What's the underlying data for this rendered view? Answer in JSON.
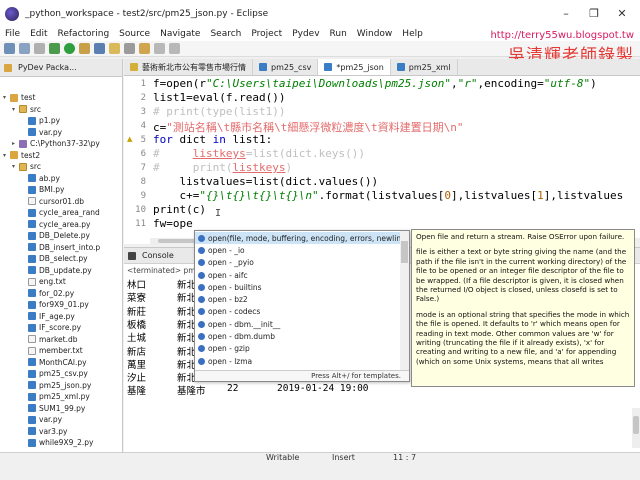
{
  "window": {
    "title": "_python_workspace - test2/src/pm25_json.py - Eclipse",
    "minimize": "–",
    "maximize": "❐",
    "close": "✕"
  },
  "watermark": {
    "url": "http://terry55wu.blogspot.tw",
    "signature": "吳清輝老師錄製"
  },
  "menu": [
    "File",
    "Edit",
    "Refactoring",
    "Source",
    "Navigate",
    "Search",
    "Project",
    "Pydev",
    "Run",
    "Window",
    "Help"
  ],
  "explorer": {
    "tab_label": "PyDev Packa...",
    "items": [
      {
        "indent": 0,
        "twisty": "▾",
        "icon": "proj",
        "label": "test"
      },
      {
        "indent": 1,
        "twisty": "▾",
        "icon": "src",
        "label": "src"
      },
      {
        "indent": 2,
        "twisty": "",
        "icon": "py",
        "label": "p1.py"
      },
      {
        "indent": 2,
        "twisty": "",
        "icon": "py",
        "label": "var.py"
      },
      {
        "indent": 1,
        "twisty": "▸",
        "icon": "lib",
        "label": "C:\\Python37-32\\py"
      },
      {
        "indent": 0,
        "twisty": "▾",
        "icon": "proj",
        "label": "test2"
      },
      {
        "indent": 1,
        "twisty": "▾",
        "icon": "src",
        "label": "src"
      },
      {
        "indent": 2,
        "twisty": "",
        "icon": "py",
        "label": "ab.py"
      },
      {
        "indent": 2,
        "twisty": "",
        "icon": "py",
        "label": "BMI.py"
      },
      {
        "indent": 2,
        "twisty": "",
        "icon": "txt",
        "label": "cursor01.db"
      },
      {
        "indent": 2,
        "twisty": "",
        "icon": "py",
        "label": "cycle_area_rand"
      },
      {
        "indent": 2,
        "twisty": "",
        "icon": "py",
        "label": "cycle_area.py"
      },
      {
        "indent": 2,
        "twisty": "",
        "icon": "py",
        "label": "DB_Delete.py"
      },
      {
        "indent": 2,
        "twisty": "",
        "icon": "py",
        "label": "DB_insert_into.p"
      },
      {
        "indent": 2,
        "twisty": "",
        "icon": "py",
        "label": "DB_select.py"
      },
      {
        "indent": 2,
        "twisty": "",
        "icon": "py",
        "label": "DB_update.py"
      },
      {
        "indent": 2,
        "twisty": "",
        "icon": "txt",
        "label": "eng.txt"
      },
      {
        "indent": 2,
        "twisty": "",
        "icon": "py",
        "label": "for_02.py"
      },
      {
        "indent": 2,
        "twisty": "",
        "icon": "py",
        "label": "for9X9_01.py"
      },
      {
        "indent": 2,
        "twisty": "",
        "icon": "py",
        "label": "IF_age.py"
      },
      {
        "indent": 2,
        "twisty": "",
        "icon": "py",
        "label": "IF_score.py"
      },
      {
        "indent": 2,
        "twisty": "",
        "icon": "txt",
        "label": "market.db"
      },
      {
        "indent": 2,
        "twisty": "",
        "icon": "txt",
        "label": "member.txt"
      },
      {
        "indent": 2,
        "twisty": "",
        "icon": "py",
        "label": "MonthCAl.py"
      },
      {
        "indent": 2,
        "twisty": "",
        "icon": "py",
        "label": "pm25_csv.py"
      },
      {
        "indent": 2,
        "twisty": "",
        "icon": "py",
        "label": "pm25_json.py"
      },
      {
        "indent": 2,
        "twisty": "",
        "icon": "py",
        "label": "pm25_xml.py"
      },
      {
        "indent": 2,
        "twisty": "",
        "icon": "py",
        "label": "SUM1_99.py"
      },
      {
        "indent": 2,
        "twisty": "",
        "icon": "py",
        "label": "var.py"
      },
      {
        "indent": 2,
        "twisty": "",
        "icon": "py",
        "label": "var3.py"
      },
      {
        "indent": 2,
        "twisty": "",
        "icon": "py",
        "label": "while9X9_2.py"
      }
    ]
  },
  "editor_tabs": [
    {
      "label": "藝術新北市公有零售市場行情",
      "active": false
    },
    {
      "label": "pm25_csv",
      "active": false
    },
    {
      "label": "*pm25_json",
      "active": true
    },
    {
      "label": "pm25_xml",
      "active": false
    }
  ],
  "editor": {
    "line_numbers": [
      "1",
      "2",
      "3",
      "4",
      "5",
      "6",
      "7",
      "8",
      "9",
      "10",
      "11"
    ]
  },
  "autocomplete": {
    "items": [
      "open(file, mode, buffering, encoding, errors, newline,",
      "open - _io",
      "open - _pyio",
      "open - aifc",
      "open - builtins",
      "open - bz2",
      "open - codecs",
      "open - dbm.__init__",
      "open - dbm.dumb",
      "open - gzip",
      "open - lzma"
    ],
    "footer": "Press Alt+/ for templates."
  },
  "doc": {
    "paragraphs": [
      "Open file and return a stream.  Raise OSError upon failure.",
      "file is either a text or byte string giving the name (and the path if the file isn't in the current working directory) of the file to be opened or an integer file descriptor of the file to be wrapped. (If a file descriptor is given, it is closed when the returned I/O object is closed, unless closefd is set to False.)",
      "mode is an optional string that specifies the mode in which  the file is opened. It defaults to 'r' which means open for reading in  text mode.  Other common values are 'w' for writing (truncating  the file if it already exists), 'x' for creating and writing to a new file, and 'a' for appending (which on some Unix systems, means that all writes"
    ]
  },
  "console": {
    "tab_label": "Console",
    "terminated": "<terminated> pm2",
    "rows": [
      {
        "c1": "林口",
        "c2": "新北",
        "c3": "",
        "c4": ""
      },
      {
        "c1": "菜寮",
        "c2": "新北",
        "c3": "",
        "c4": ""
      },
      {
        "c1": "新莊",
        "c2": "新北",
        "c3": "",
        "c4": ""
      },
      {
        "c1": "板橋",
        "c2": "新北",
        "c3": "",
        "c4": ""
      },
      {
        "c1": "土城",
        "c2": "新北",
        "c3": "",
        "c4": ""
      },
      {
        "c1": "新店",
        "c2": "新北",
        "c3": "",
        "c4": ""
      },
      {
        "c1": "萬里",
        "c2": "新北",
        "c3": "",
        "c4": ""
      },
      {
        "c1": "汐止",
        "c2": "新北",
        "c3": "",
        "c4": ""
      },
      {
        "c1": "基隆",
        "c2": "基隆市",
        "c3": "22",
        "c4": "2019-01-24 19:00"
      }
    ]
  },
  "status": {
    "mode": "Writable",
    "insert": "Insert",
    "position": "11 : 7"
  },
  "colors": {
    "keyword": "#0000c0",
    "string": "#008000",
    "comment": "#bfbfbf",
    "selection": "#cde4f7",
    "doc_bg": "#ffffe1"
  }
}
